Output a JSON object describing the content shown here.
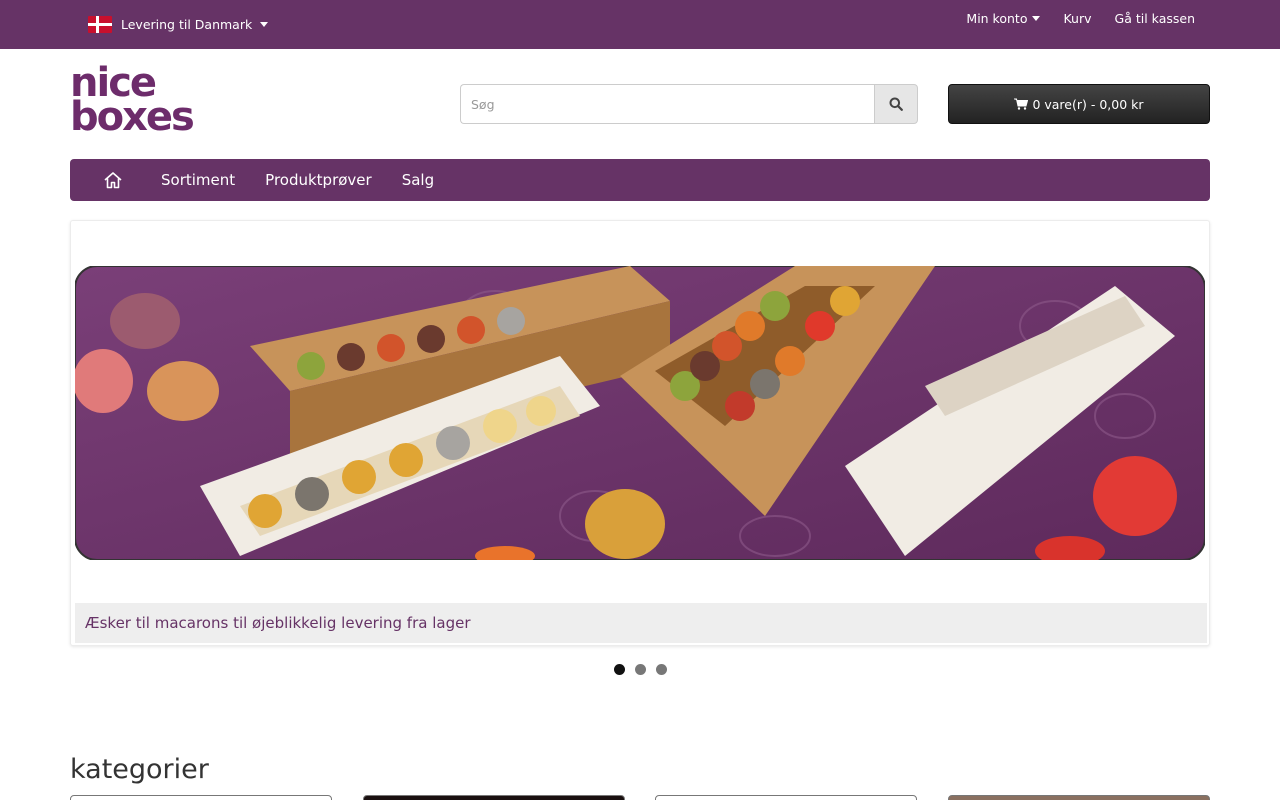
{
  "topbar": {
    "shipping_label": "Levering til Danmark",
    "links": [
      {
        "label": "Min konto",
        "dropdown": true
      },
      {
        "label": "Kurv",
        "dropdown": false
      },
      {
        "label": "Gå til kassen",
        "dropdown": false
      }
    ]
  },
  "logo": {
    "line1": "nice",
    "line2": "boxes"
  },
  "search": {
    "placeholder": "Søg"
  },
  "cart": {
    "label": "0 vare(r) - 0,00 kr"
  },
  "nav": {
    "items": [
      "Sortiment",
      "Produktprøver",
      "Salg"
    ]
  },
  "slideshow": {
    "caption": "Æsker til macarons til øjeblikkelig levering fra lager",
    "dot_count": 3,
    "active_index": 0
  },
  "categories": {
    "title": "kategorier"
  },
  "colors": {
    "brand": "#663366",
    "cart_bg": "#222222"
  }
}
